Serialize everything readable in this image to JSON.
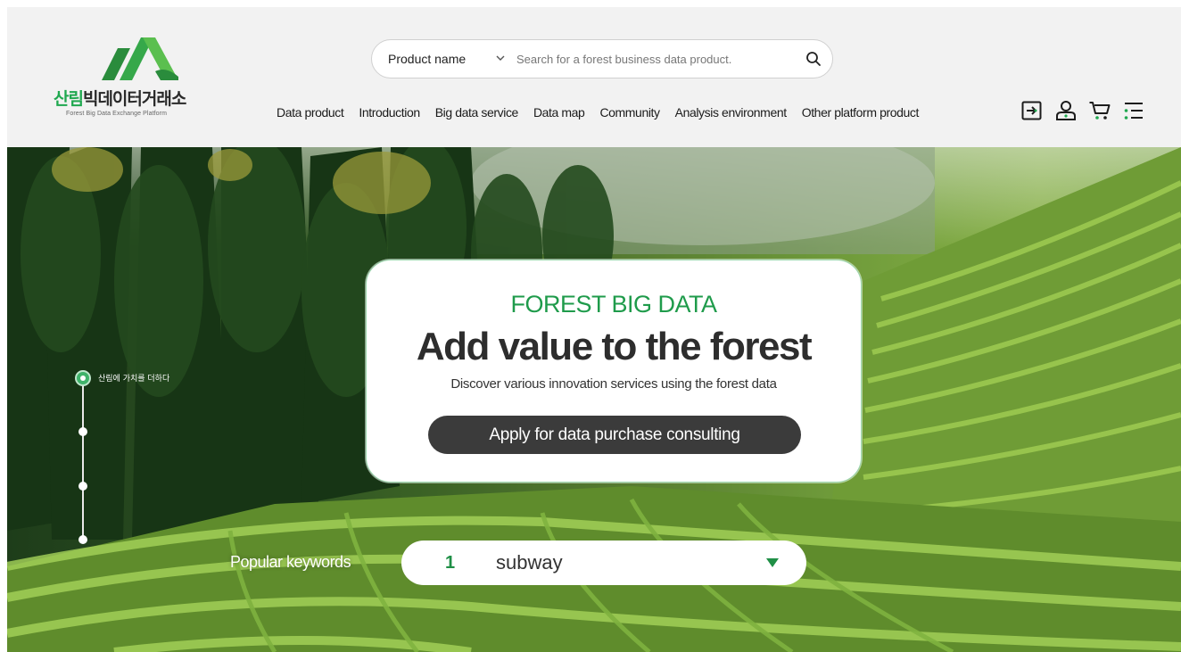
{
  "brand": {
    "name_kr_green": "산림",
    "name_kr_dark": "빅데이터거래소",
    "name_en": "Forest Big Data Exchange Platform",
    "accent_color": "#1fa84f"
  },
  "search": {
    "category": "Product name",
    "placeholder": "Search for a forest business data product.",
    "icons": {
      "category": "chevron-down",
      "submit": "magnifier"
    }
  },
  "nav": {
    "items": [
      "Data product",
      "Introduction",
      "Big data service",
      "Data map",
      "Community",
      "Analysis environment",
      "Other platform product"
    ]
  },
  "header_icons": [
    "login-icon",
    "user-icon",
    "cart-icon",
    "menu-icon"
  ],
  "hero": {
    "timeline_label": "산림에 가치를 더하다",
    "kicker": "FOREST BIG DATA",
    "title": "Add value to the forest",
    "subtitle": "Discover various innovation services using the forest data",
    "cta_label": "Apply for data purchase consulting",
    "cta_color": "#3b3b3b"
  },
  "popular_keywords": {
    "label": "Popular keywords",
    "rank": "1",
    "term": "subway",
    "rank_color": "#1f8f46"
  }
}
